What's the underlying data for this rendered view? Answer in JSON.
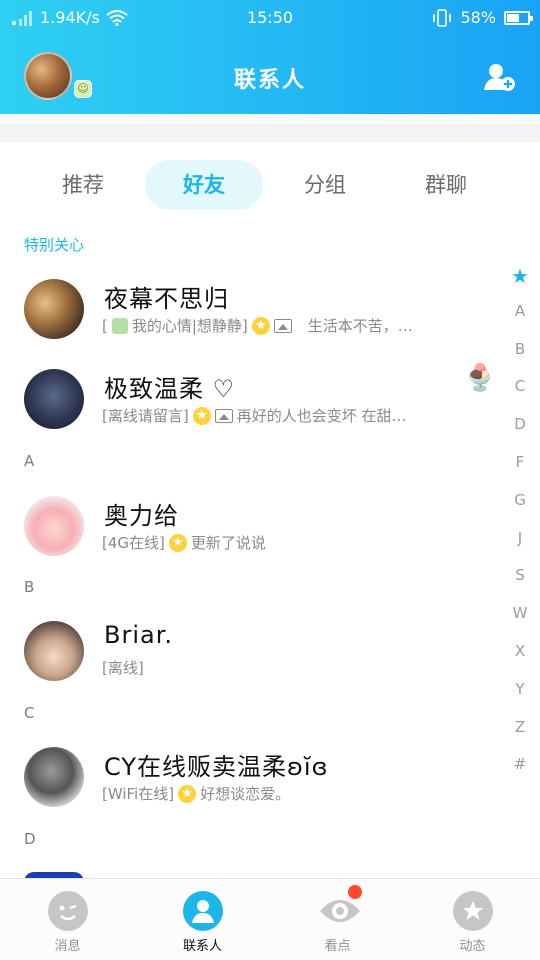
{
  "status_bar": {
    "speed": "1.94K/s",
    "time": "15:50",
    "battery_percent": "58%",
    "battery_level": 0.58
  },
  "header": {
    "title": "联系人"
  },
  "tabs": [
    {
      "label": "推荐",
      "active": false
    },
    {
      "label": "好友",
      "active": true
    },
    {
      "label": "分组",
      "active": false
    },
    {
      "label": "群聊",
      "active": false
    }
  ],
  "sections": {
    "special": "特别关心",
    "a": "A",
    "b": "B",
    "c": "C",
    "d": "D"
  },
  "contacts": [
    {
      "name": "夜幕不思归",
      "status_prefix": "[",
      "status_mid": "我的心情|想静静]",
      "status_text": "生活本不苦，…"
    },
    {
      "name": "极致温柔 ♡",
      "status_prefix": "[离线请留言]",
      "status_text": "再好的人也会变坏 在甜…"
    },
    {
      "name": "奥力给",
      "status_prefix": "[4G在线]",
      "status_text": "更新了说说"
    },
    {
      "name": "Briar.",
      "status_prefix": "[离线]",
      "status_text": ""
    },
    {
      "name": "CY在线贩卖温柔ʚĭɞ",
      "status_prefix": "[WiFi在线]",
      "status_text": "好想谈恋爱。"
    }
  ],
  "index_bar": [
    "★",
    "A",
    "B",
    "C",
    "D",
    "F",
    "G",
    "J",
    "S",
    "W",
    "X",
    "Y",
    "Z",
    "#"
  ],
  "bottom_nav": [
    {
      "label": "消息",
      "icon": "message-face-icon",
      "active": false
    },
    {
      "label": "联系人",
      "icon": "contact-person-icon",
      "active": true
    },
    {
      "label": "看点",
      "icon": "eye-icon",
      "active": false,
      "has_dot": true
    },
    {
      "label": "动态",
      "icon": "planet-star-icon",
      "active": false
    }
  ],
  "colors": {
    "accent": "#1ab8e8",
    "header_from": "#2fd0f3",
    "header_to": "#1aa3f5",
    "notify_dot": "#ff4b2b"
  }
}
